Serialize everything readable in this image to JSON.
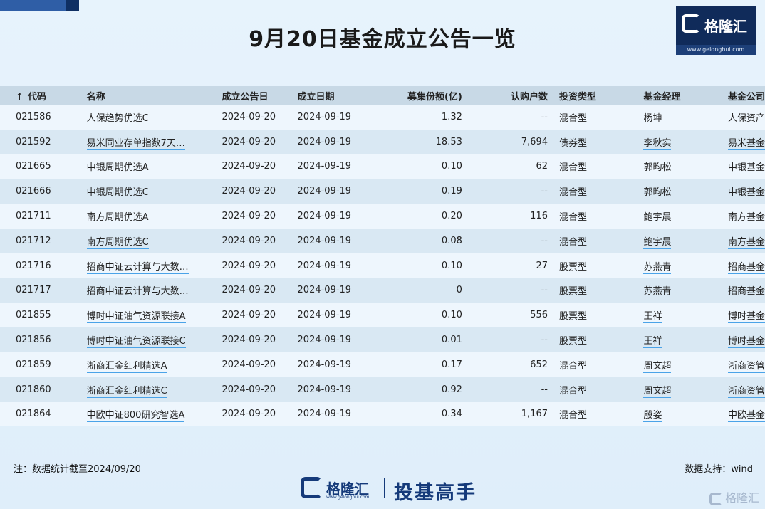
{
  "title": "9月20日基金成立公告一览",
  "brand": {
    "name": "格隆汇",
    "url": "www.gelonghui.com"
  },
  "table": {
    "sort_arrow": "↑",
    "headers": {
      "code": "代码",
      "name": "名称",
      "announce_date": "成立公告日",
      "establish_date": "成立日期",
      "shares": "募集份额(亿)",
      "households": "认购户数",
      "type": "投资类型",
      "manager": "基金经理",
      "company": "基金公司"
    },
    "rows": [
      {
        "code": "021586",
        "name": "人保趋势优选C",
        "announce_date": "2024-09-20",
        "establish_date": "2024-09-19",
        "shares": "1.32",
        "households": "--",
        "type": "混合型",
        "manager": "杨坤",
        "company": "人保资产"
      },
      {
        "code": "021592",
        "name": "易米同业存单指数7天…",
        "announce_date": "2024-09-20",
        "establish_date": "2024-09-19",
        "shares": "18.53",
        "households": "7,694",
        "type": "债券型",
        "manager": "李秋实",
        "company": "易米基金"
      },
      {
        "code": "021665",
        "name": "中银周期优选A",
        "announce_date": "2024-09-20",
        "establish_date": "2024-09-19",
        "shares": "0.10",
        "households": "62",
        "type": "混合型",
        "manager": "郭昀松",
        "company": "中银基金"
      },
      {
        "code": "021666",
        "name": "中银周期优选C",
        "announce_date": "2024-09-20",
        "establish_date": "2024-09-19",
        "shares": "0.19",
        "households": "--",
        "type": "混合型",
        "manager": "郭昀松",
        "company": "中银基金"
      },
      {
        "code": "021711",
        "name": "南方周期优选A",
        "announce_date": "2024-09-20",
        "establish_date": "2024-09-19",
        "shares": "0.20",
        "households": "116",
        "type": "混合型",
        "manager": "鲍宇晨",
        "company": "南方基金"
      },
      {
        "code": "021712",
        "name": "南方周期优选C",
        "announce_date": "2024-09-20",
        "establish_date": "2024-09-19",
        "shares": "0.08",
        "households": "--",
        "type": "混合型",
        "manager": "鲍宇晨",
        "company": "南方基金"
      },
      {
        "code": "021716",
        "name": "招商中证云计算与大数…",
        "announce_date": "2024-09-20",
        "establish_date": "2024-09-19",
        "shares": "0.10",
        "households": "27",
        "type": "股票型",
        "manager": "苏燕青",
        "company": "招商基金"
      },
      {
        "code": "021717",
        "name": "招商中证云计算与大数…",
        "announce_date": "2024-09-20",
        "establish_date": "2024-09-19",
        "shares": "0",
        "households": "--",
        "type": "股票型",
        "manager": "苏燕青",
        "company": "招商基金"
      },
      {
        "code": "021855",
        "name": "博时中证油气资源联接A",
        "announce_date": "2024-09-20",
        "establish_date": "2024-09-19",
        "shares": "0.10",
        "households": "556",
        "type": "股票型",
        "manager": "王祥",
        "company": "博时基金"
      },
      {
        "code": "021856",
        "name": "博时中证油气资源联接C",
        "announce_date": "2024-09-20",
        "establish_date": "2024-09-19",
        "shares": "0.01",
        "households": "--",
        "type": "股票型",
        "manager": "王祥",
        "company": "博时基金"
      },
      {
        "code": "021859",
        "name": "浙商汇金红利精选A",
        "announce_date": "2024-09-20",
        "establish_date": "2024-09-19",
        "shares": "0.17",
        "households": "652",
        "type": "混合型",
        "manager": "周文超",
        "company": "浙商资管"
      },
      {
        "code": "021860",
        "name": "浙商汇金红利精选C",
        "announce_date": "2024-09-20",
        "establish_date": "2024-09-19",
        "shares": "0.92",
        "households": "--",
        "type": "混合型",
        "manager": "周文超",
        "company": "浙商资管"
      },
      {
        "code": "021864",
        "name": "中欧中证800研究智选A",
        "announce_date": "2024-09-20",
        "establish_date": "2024-09-19",
        "shares": "0.34",
        "households": "1,167",
        "type": "混合型",
        "manager": "殷姿",
        "company": "中欧基金"
      }
    ]
  },
  "footer": {
    "note": "注：数据统计截至2024/09/20",
    "source": "数据支持：wind",
    "logo_name": "格隆汇",
    "logo_url": "www.gelonghui.com",
    "slogan": "投基高手",
    "watermark": "格隆汇"
  },
  "colors": {
    "header_bg": "#c8d9e6",
    "brand_navy": "#102b5a",
    "link_underline": "#4aa3e8"
  }
}
